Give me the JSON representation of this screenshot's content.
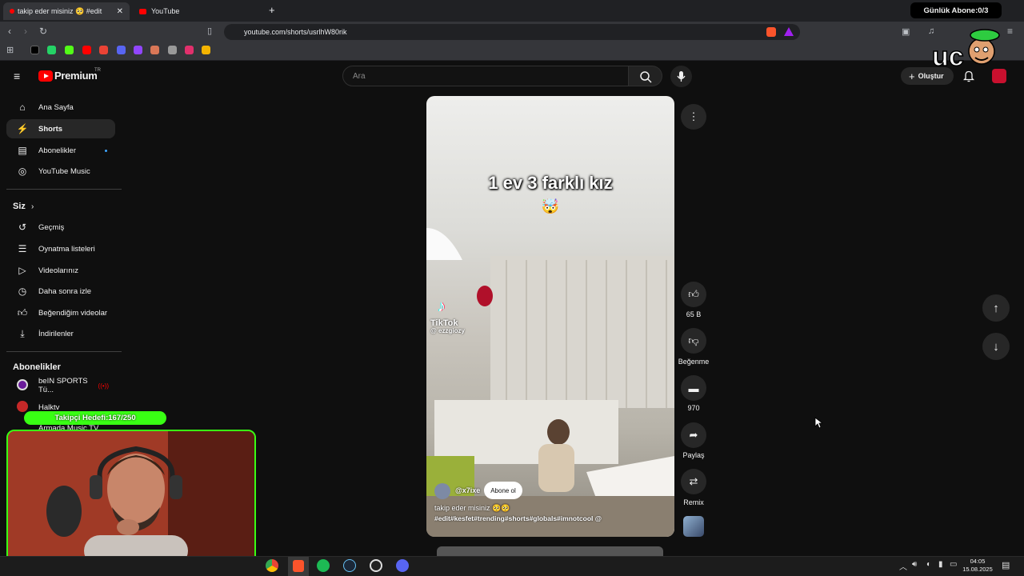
{
  "browser": {
    "tabs": [
      {
        "title": "takip eder misiniz 🥺 #edit"
      },
      {
        "title": "YouTube"
      }
    ],
    "new_tab": "+",
    "url": "youtube.com/shorts/usrlhW80rik"
  },
  "stream_overlay": {
    "daily_subs": "Günlük Abone:0/3",
    "follower_goal": "Takipçi Hedefi:167/250"
  },
  "header": {
    "brand": "Premium",
    "brand_sup": "TR",
    "search_placeholder": "Ara",
    "create_label": "Oluştur"
  },
  "sidebar": {
    "main": [
      {
        "label": "Ana Sayfa",
        "icon": "home-icon"
      },
      {
        "label": "Shorts",
        "icon": "shorts-icon",
        "selected": true
      },
      {
        "label": "Abonelikler",
        "icon": "subscriptions-icon"
      },
      {
        "label": "YouTube Music",
        "icon": "music-icon"
      }
    ],
    "you_title": "Siz",
    "you": [
      {
        "label": "Geçmiş",
        "icon": "history-icon"
      },
      {
        "label": "Oynatma listeleri",
        "icon": "playlist-icon"
      },
      {
        "label": "Videolarınız",
        "icon": "your-videos-icon"
      },
      {
        "label": "Daha sonra izle",
        "icon": "watch-later-icon"
      },
      {
        "label": "Beğendiğim videolar",
        "icon": "liked-icon"
      },
      {
        "label": "İndirilenler",
        "icon": "download-icon"
      }
    ],
    "subs_title": "Abonelikler",
    "subs": [
      {
        "label": "beIN SPORTS Tü..."
      },
      {
        "label": "Halktv"
      },
      {
        "label": "Armada Music TV"
      }
    ]
  },
  "short": {
    "overlay_title": "1 ev 3 farklı kız",
    "overlay_emoji": "🤯",
    "tiktok_label": "TikTok",
    "tiktok_user": "@ ezzgiozy",
    "channel": "@x7ixe",
    "subscribe": "Abone ol",
    "caption": "takip eder misiniz 🥺🥺",
    "hashtags": "#edit#kesfet#trending#shorts#globals#imnotcool @"
  },
  "actions": {
    "likes": "65 B",
    "dislike": "Beğenme",
    "comments": "970",
    "share": "Paylaş",
    "remix": "Remix"
  },
  "taskbar": {
    "time": "04:05",
    "date": "15.08.2025"
  },
  "colors": {
    "accent_green": "#39ff14",
    "youtube_red": "#ff0000",
    "background": "#0f0f0f"
  }
}
